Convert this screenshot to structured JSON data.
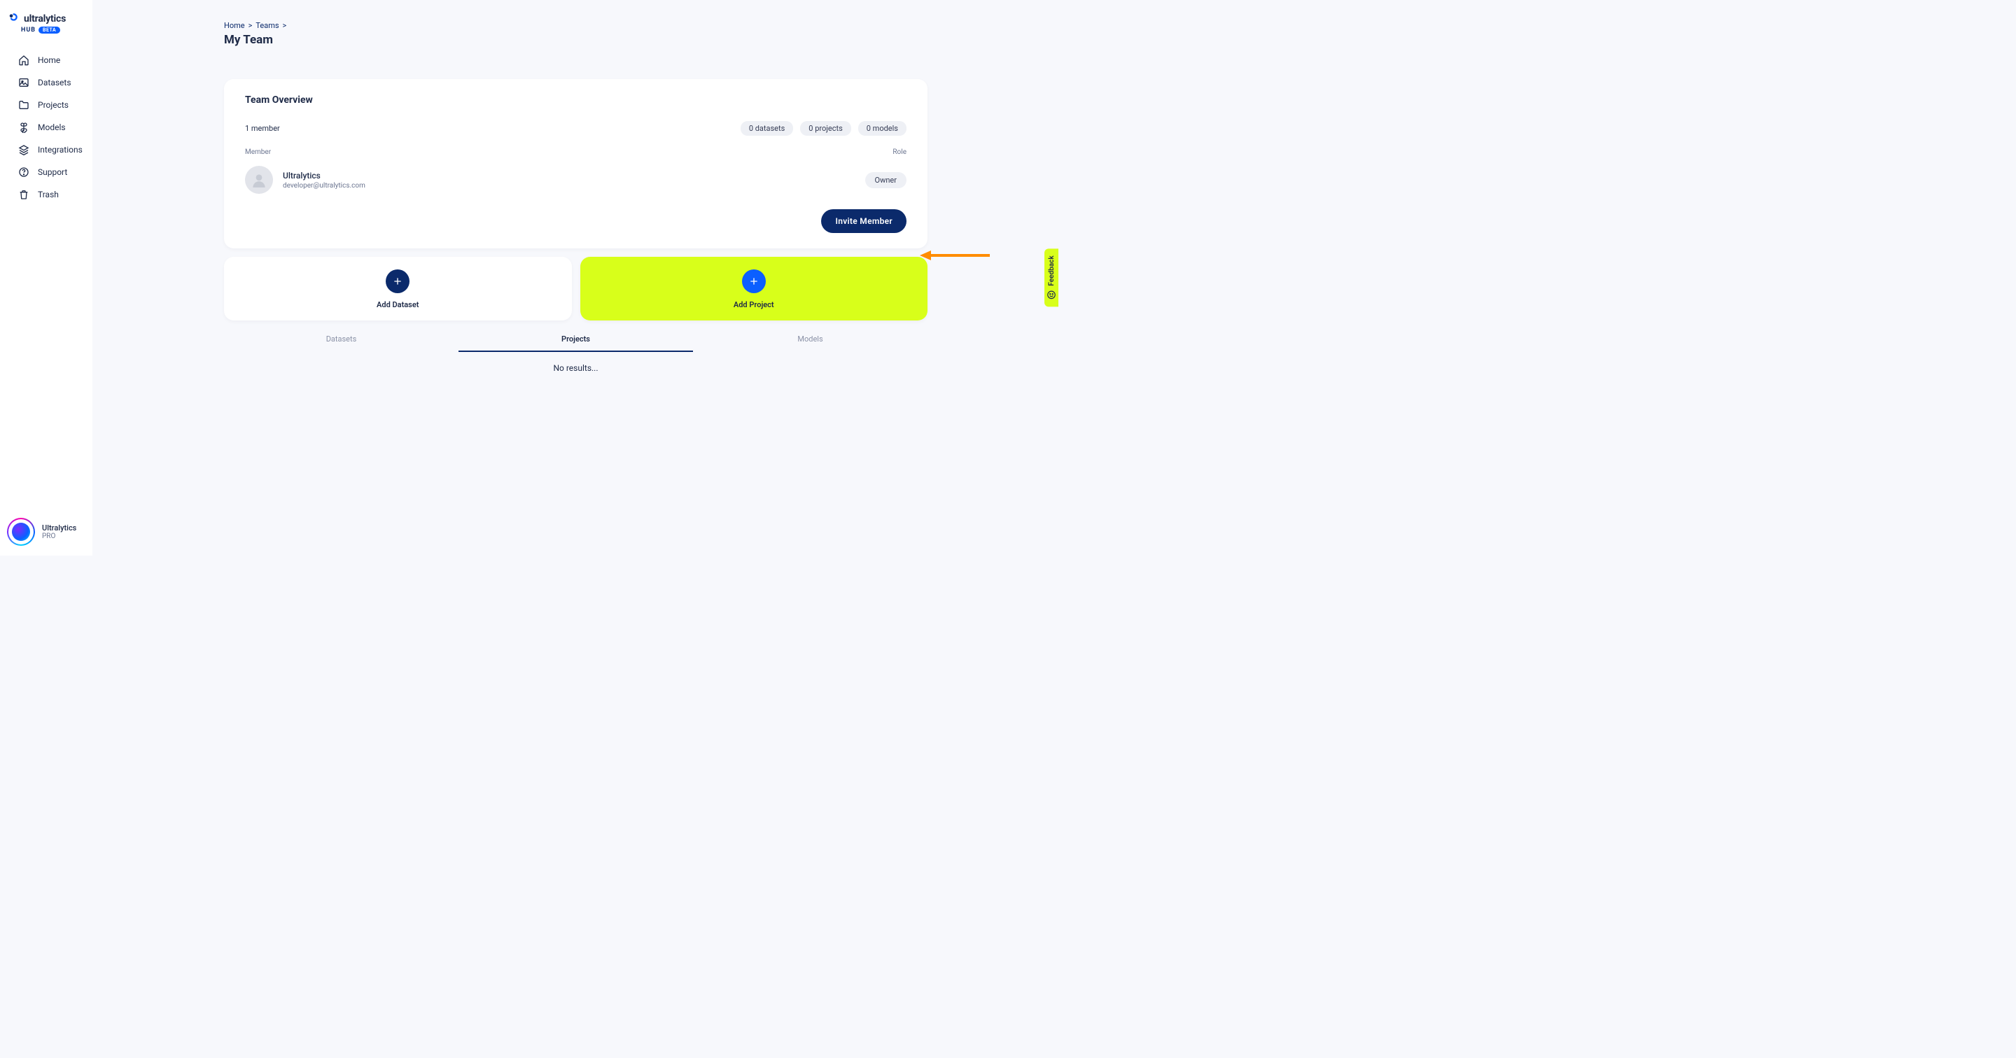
{
  "brand": {
    "name": "ultralytics",
    "hub": "HUB",
    "beta": "BETA"
  },
  "sidebar": {
    "items": [
      {
        "label": "Home"
      },
      {
        "label": "Datasets"
      },
      {
        "label": "Projects"
      },
      {
        "label": "Models"
      },
      {
        "label": "Integrations"
      },
      {
        "label": "Support"
      },
      {
        "label": "Trash"
      }
    ],
    "user": {
      "name": "Ultralytics",
      "plan": "PRO"
    }
  },
  "breadcrumb": {
    "home": "Home",
    "teams": "Teams"
  },
  "page_title": "My Team",
  "overview": {
    "title": "Team Overview",
    "member_count": "1 member",
    "badges": {
      "datasets": "0 datasets",
      "projects": "0 projects",
      "models": "0 models"
    },
    "head": {
      "member": "Member",
      "role": "Role"
    },
    "member": {
      "name": "Ultralytics",
      "email": "developer@ultralytics.com",
      "role": "Owner"
    },
    "invite": "Invite Member"
  },
  "add": {
    "dataset": "Add Dataset",
    "project": "Add Project"
  },
  "tabs": {
    "datasets": "Datasets",
    "projects": "Projects",
    "models": "Models"
  },
  "no_results": "No results...",
  "feedback": "Feedback"
}
